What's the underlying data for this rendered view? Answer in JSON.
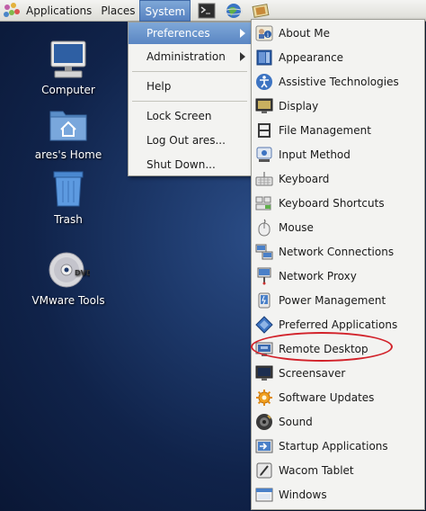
{
  "panel": {
    "menus": [
      "Applications",
      "Places",
      "System"
    ],
    "launchers": [
      "terminal-icon",
      "web-browser-icon",
      "notes-icon"
    ]
  },
  "desktop": {
    "icons": [
      {
        "label": "Computer",
        "icon": "computer-icon"
      },
      {
        "label": "ares's Home",
        "icon": "home-folder-icon"
      },
      {
        "label": "Trash",
        "icon": "trash-icon"
      },
      {
        "label": "VMware Tools",
        "icon": "dvd-icon",
        "badge": "DVD"
      }
    ]
  },
  "system_menu": {
    "items": [
      {
        "label": "Preferences",
        "submenu": true,
        "highlighted": true
      },
      {
        "label": "Administration",
        "submenu": true
      },
      {
        "label": "Help"
      },
      {
        "label": "Lock Screen"
      },
      {
        "label": "Log Out ares..."
      },
      {
        "label": "Shut Down..."
      }
    ]
  },
  "preferences_menu": {
    "items": [
      {
        "label": "About Me",
        "icon": "about-me-icon"
      },
      {
        "label": "Appearance",
        "icon": "appearance-icon"
      },
      {
        "label": "Assistive Technologies",
        "icon": "accessibility-icon"
      },
      {
        "label": "Display",
        "icon": "display-icon"
      },
      {
        "label": "File Management",
        "icon": "file-management-icon"
      },
      {
        "label": "Input Method",
        "icon": "input-method-icon"
      },
      {
        "label": "Keyboard",
        "icon": "keyboard-icon"
      },
      {
        "label": "Keyboard Shortcuts",
        "icon": "keyboard-shortcuts-icon"
      },
      {
        "label": "Mouse",
        "icon": "mouse-icon"
      },
      {
        "label": "Network Connections",
        "icon": "network-connections-icon"
      },
      {
        "label": "Network Proxy",
        "icon": "network-proxy-icon"
      },
      {
        "label": "Power Management",
        "icon": "power-management-icon"
      },
      {
        "label": "Preferred Applications",
        "icon": "preferred-applications-icon"
      },
      {
        "label": "Remote Desktop",
        "icon": "remote-desktop-icon",
        "circled": true
      },
      {
        "label": "Screensaver",
        "icon": "screensaver-icon"
      },
      {
        "label": "Software Updates",
        "icon": "software-updates-icon"
      },
      {
        "label": "Sound",
        "icon": "sound-icon"
      },
      {
        "label": "Startup Applications",
        "icon": "startup-applications-icon"
      },
      {
        "label": "Wacom Tablet",
        "icon": "wacom-tablet-icon"
      },
      {
        "label": "Windows",
        "icon": "windows-icon"
      }
    ]
  },
  "colors": {
    "menu_highlight": "#6b96cf",
    "annotation_circle": "#d2222a",
    "desktop_background": "#1c3768"
  }
}
